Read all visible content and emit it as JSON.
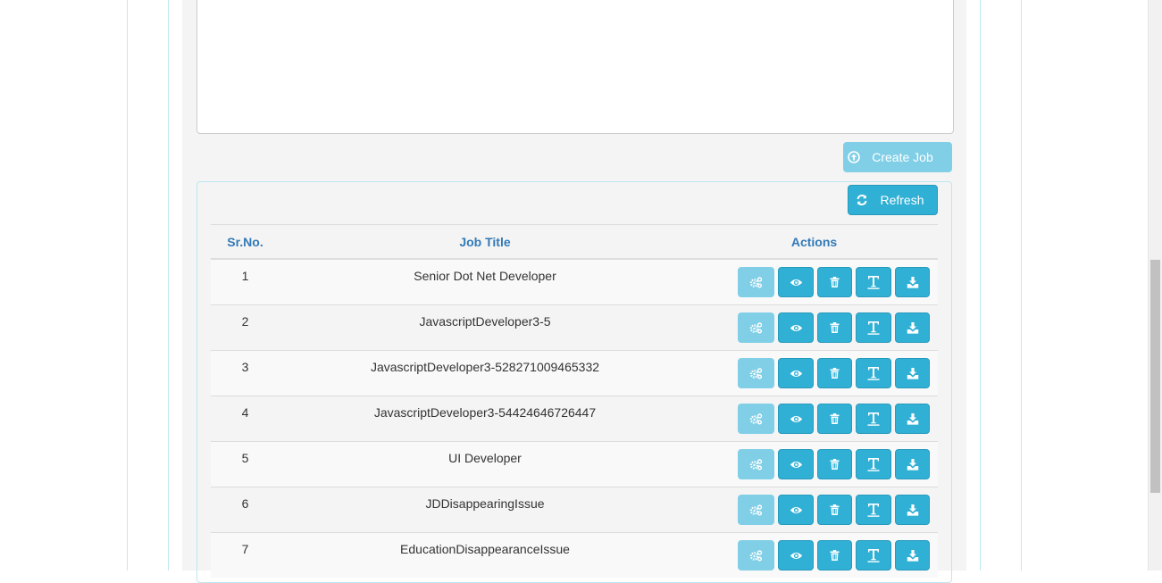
{
  "form": {
    "create_job_label": "Create Job"
  },
  "jobs": {
    "refresh_label": "Refresh",
    "columns": [
      "Sr.No.",
      "Job Title",
      "Actions"
    ],
    "rows": [
      {
        "sr": "1",
        "title": "Senior Dot Net Developer"
      },
      {
        "sr": "2",
        "title": "JavascriptDeveloper3-5"
      },
      {
        "sr": "3",
        "title": "JavascriptDeveloper3-528271009465332"
      },
      {
        "sr": "4",
        "title": "JavascriptDeveloper3-54424646726447"
      },
      {
        "sr": "5",
        "title": "UI Developer"
      },
      {
        "sr": "6",
        "title": "JDDisappearingIssue"
      },
      {
        "sr": "7",
        "title": "EducationDisappearanceIssue"
      }
    ],
    "action_icons": [
      "cogs-icon",
      "eye-icon",
      "trash-icon",
      "text-icon",
      "download-icon"
    ]
  },
  "colors": {
    "accent": "#31b0d5",
    "accent_disabled": "#80cfe6",
    "header_text": "#337ab7",
    "panel_border": "#bce8f1"
  }
}
